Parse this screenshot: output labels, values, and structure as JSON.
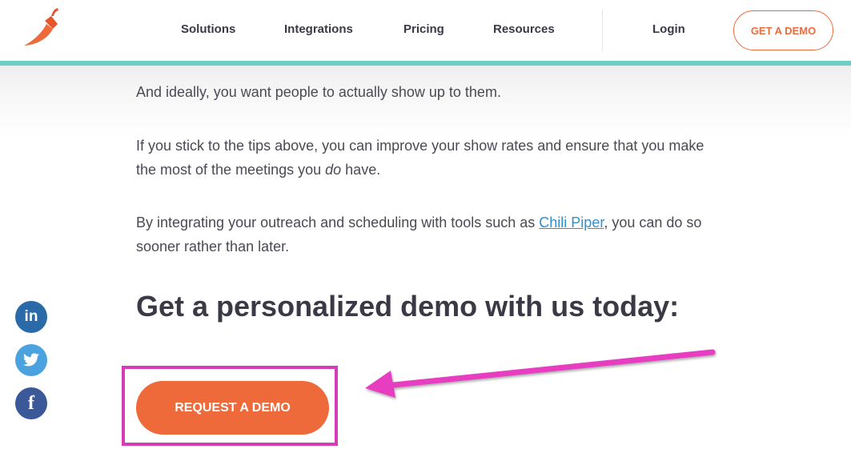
{
  "header": {
    "nav": [
      {
        "label": "Solutions"
      },
      {
        "label": "Integrations"
      },
      {
        "label": "Pricing"
      },
      {
        "label": "Resources"
      }
    ],
    "login_label": "Login",
    "cta_label": "GET A DEMO"
  },
  "article": {
    "para1": "And ideally, you want people to actually show up to them.",
    "para2_a": "If you stick to the tips above, you can improve your show rates and ensure that you make the most of the meetings you ",
    "para2_em": "do",
    "para2_b": " have.",
    "para3_a": "By integrating your outreach and scheduling with tools such as ",
    "para3_link": "Chili Piper",
    "para3_b": ", you can do so sooner rather than later.",
    "heading": "Get a personalized demo with us today:",
    "button_label": "REQUEST A DEMO"
  },
  "social": [
    {
      "icon": "linkedin-icon",
      "glyph": "in",
      "color": "#2a6aa8"
    },
    {
      "icon": "twitter-icon",
      "glyph": "",
      "color": "#4aa3df"
    },
    {
      "icon": "facebook-icon",
      "glyph": "f",
      "color": "#3b5998"
    }
  ],
  "colors": {
    "accent": "#ef6a3a",
    "teal_bar": "#6cd0c4",
    "annotation": "#d63bb8",
    "link": "#2f8fcf"
  }
}
